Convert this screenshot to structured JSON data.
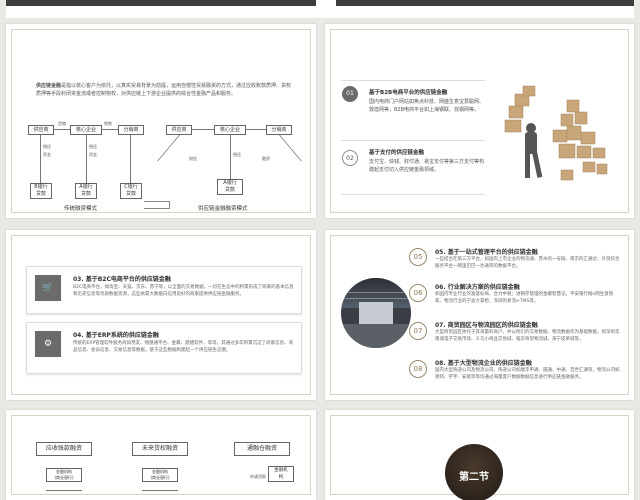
{
  "slide1": {
    "intro_bold": "供应链金融",
    "intro_text": "是指以核心客户为依托，以真实贸易背景为前提，运用自偿性贸易融资的方式，通过应收账款质押、货权质押等手段封闭资金流或者控制物权，对供应链上下游企业提供的综合性金融产品和服务。",
    "left_diagram": {
      "supplier": "供应商",
      "core": "核心企业",
      "distributor": "分销商",
      "goods_top": "货物",
      "goods_top2": "销售",
      "cash1": "资金",
      "pay1": "偿还",
      "cash2": "资金",
      "pay2": "偿还",
      "bank_b": "B银行\n贷款",
      "bank_a": "A银行\n贷款",
      "bank_c": "C银行\n贷款",
      "title": "传统融资模式"
    },
    "right_diagram": {
      "supplier": "供应商",
      "core": "核心企业",
      "distributor": "分销商",
      "credit": "授信",
      "repay": "偿还",
      "finance": "融资",
      "bank": "A银行\n贷款",
      "title": "供应链金融融资模式"
    }
  },
  "slide2": {
    "items": [
      {
        "num": "01",
        "title": "基于B2B电商平台的供应链金融",
        "text": "国内电商门户网站如焦点科技、网盛生意宝慧聪网、敦煌网等，B2B电商平台如上海钢联、找钢网等。"
      },
      {
        "num": "02",
        "title": "基于支付的供应链金融",
        "text": "支付宝、快钱、财付通、易宝支付等第三方支付等构建起支付切入供应链金融领域。"
      }
    ]
  },
  "slide3": {
    "cards": [
      {
        "title": "03. 基于B2C电商平台的供应链金融",
        "text": "B2C电商平台，如淘宝、天猫、京东、苏宁等，以全面的交易数据，一切在生态中的积累形成了商家的基本信息和历史信息等优质数据资源，这些依靠大数据向信用良好的商家提供供应链金融服务。",
        "icon": "cart-icon"
      },
      {
        "title": "04. 基于ERP系统的供应链金融",
        "text": "传统的ERP管理软件服务商如用友、畅捷通平台、金蝶、鼎捷软件、等等，其通过多年积累沉淀了商家信息、商品信息、会员信息、交易信息等数据，基于这些数据构建起一个供应链生态圈。",
        "icon": "gears-icon"
      }
    ]
  },
  "slide4": {
    "items": [
      {
        "num": "05",
        "title": "05. 基于一站式管理平台的供应链金融",
        "text": "一些结合在第三方平台，如国内上市企业的物流通、苏州的一号链、南京的汇通达、外贸综合服务平台一网里巴巴一达通等的数据平台。"
      },
      {
        "num": "06",
        "title": "06. 行业解决方案的供应链金融",
        "text": "如国内专业行业的富基标商、合力中税；进销存管理的金螺智慧记，平安银行橙e网生意管家、物流行业的宁波大掌柜、深圳的易流e-TMS等。"
      },
      {
        "num": "07",
        "title": "07. 商贸园区与物流园区的供应链金融",
        "text": "大型商贸园区依托于其海量的商户，并以他们的交易数据、物流数据作为基础数据，如深圳华南城电子交易市场、义乌小商品交易城、临沂商贸物流城、海宁皮革城等。"
      },
      {
        "num": "08",
        "title": "08. 基于大型物流企业的供应链金融",
        "text": "国内大型快递公司及物流公司，快递公司如顺丰申通、圆通、中通、百世汇通等，物流公司如德邦、宇宇、安能等等均通过海量客户数据数据信息进行供应链金融服务。"
      }
    ]
  },
  "slide5": {
    "heads": [
      "应收账款融资",
      "未来货权融资",
      "通融仓融资"
    ],
    "box1": "金融机构\n(商业银行)",
    "box2": "金融机构\n(商业银行)",
    "box3": "金融机\n构",
    "lbl1": "申请贷款"
  },
  "slide6": {
    "section": "第二节"
  }
}
